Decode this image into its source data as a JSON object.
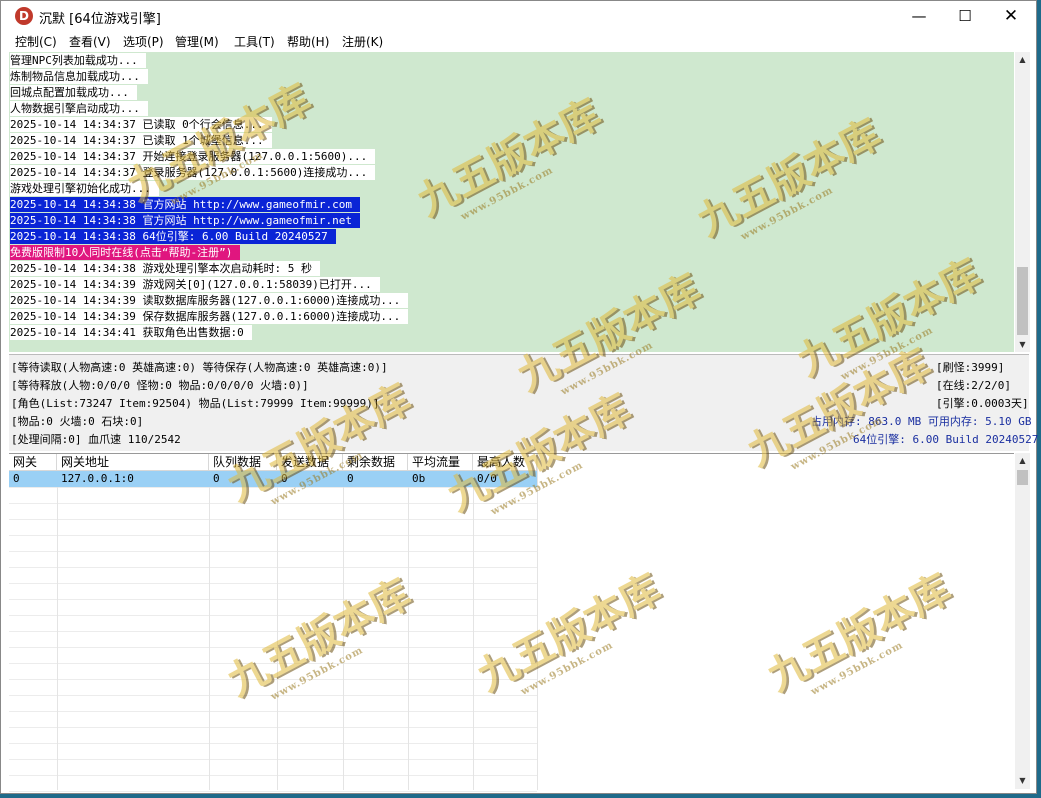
{
  "window": {
    "title": "沉默 [64位游戏引擎]",
    "app_icon": "D"
  },
  "menu": [
    "控制(C)",
    "查看(V)",
    "选项(P)",
    "管理(M)",
    "工具(T)",
    "帮助(H)",
    "注册(K)"
  ],
  "log": [
    {
      "text": "管理NPC列表加载成功...",
      "style": ""
    },
    {
      "text": "炼制物品信息加载成功...",
      "style": ""
    },
    {
      "text": "回城点配置加载成功...",
      "style": ""
    },
    {
      "text": "人物数据引擎启动成功...",
      "style": ""
    },
    {
      "text": "2025-10-14 14:34:37 已读取 0个行会信息...",
      "style": ""
    },
    {
      "text": "2025-10-14 14:34:37 已读取 1个城堡信息...",
      "style": ""
    },
    {
      "text": "2025-10-14 14:34:37 开始连接登录服务器(127.0.0.1:5600)...",
      "style": ""
    },
    {
      "text": "2025-10-14 14:34:37 登录服务器(127.0.0.1:5600)连接成功...",
      "style": ""
    },
    {
      "text": "游戏处理引擎初始化成功...",
      "style": ""
    },
    {
      "text": "2025-10-14 14:34:38 官方网站 http://www.gameofmir.com",
      "style": "hl-blue"
    },
    {
      "text": "2025-10-14 14:34:38 官方网站 http://www.gameofmir.net",
      "style": "hl-blue"
    },
    {
      "text": "2025-10-14 14:34:38 64位引擎: 6.00 Build 20240527",
      "style": "hl-blue"
    },
    {
      "text": "免费版限制10人同时在线(点击“帮助-注册”)",
      "style": "hl-pink"
    },
    {
      "text": "2025-10-14 14:34:38 游戏处理引擎本次启动耗时: 5 秒",
      "style": ""
    },
    {
      "text": "2025-10-14 14:34:39 游戏网关[0](127.0.0.1:58039)已打开...",
      "style": ""
    },
    {
      "text": "2025-10-14 14:34:39 读取数据库服务器(127.0.0.1:6000)连接成功...",
      "style": ""
    },
    {
      "text": "2025-10-14 14:34:39 保存数据库服务器(127.0.0.1:6000)连接成功...",
      "style": ""
    },
    {
      "text": "2025-10-14 14:34:41 获取角色出售数据:0",
      "style": ""
    }
  ],
  "status": {
    "left": [
      "[等待读取(人物高速:0 英雄高速:0) 等待保存(人物高速:0 英雄高速:0)]",
      "[等待释放(人物:0/0/0 怪物:0 物品:0/0/0/0 火墙:0)]",
      "[角色(List:73247 Item:92504) 物品(List:79999 Item:99999)]",
      "[物品:0 火墙:0 石块:0]",
      "[处理间隔:0]     血爪速 110/2542"
    ],
    "right": [
      "[刷怪:3999]",
      "[在线:2/2/0]",
      "[引擎:0.0003天]"
    ],
    "memory": "占用内存: 863.0 MB 可用内存: 5.10 GB",
    "engine": "64位引擎: 6.00 Build 20240527"
  },
  "gateway_table": {
    "headers": [
      "网关",
      "网关地址",
      "队列数据",
      "发送数据",
      "剩余数据",
      "平均流量",
      "最高人数"
    ],
    "rows": [
      [
        "0",
        "127.0.0.1:0",
        "0",
        "0",
        "0",
        "0b",
        "0/0"
      ]
    ]
  },
  "watermark": {
    "text": "九五版本库",
    "url": "www.95bbk.com"
  },
  "colors": {
    "log_bg": "#cfe8cf",
    "hl_blue": "#0a24d6",
    "hl_pink": "#e0167f",
    "row_selected": "#9ad0f5"
  }
}
